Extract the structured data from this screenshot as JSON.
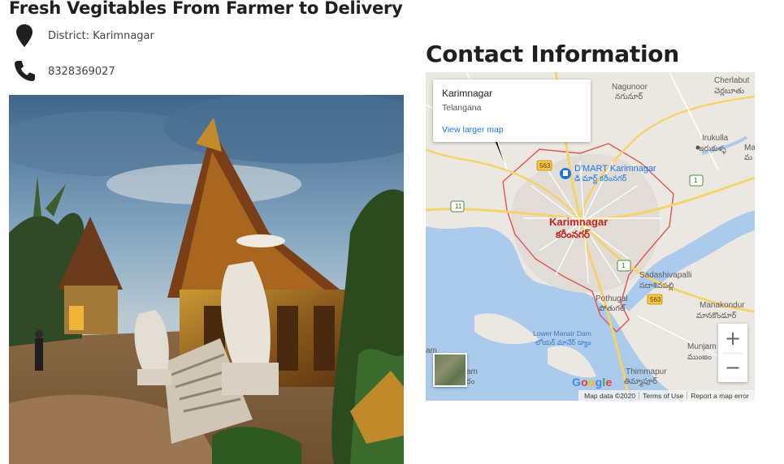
{
  "header": {
    "title": "Fresh Vegitables From Farmer to Delivery"
  },
  "contact": {
    "district": "District: Karimnagar",
    "phone": "8328369027",
    "icons": {
      "location": "map-marker-icon",
      "phone": "phone-icon"
    }
  },
  "photo": {
    "alt": "Temple photograph"
  },
  "contact_heading": "Contact Information",
  "map": {
    "info_card": {
      "place": "Karimnagar",
      "state": "Telangana",
      "link": "View larger map"
    },
    "labels": {
      "nagunoor": "Nagunoor",
      "nagunoor_te": "నగునూర్",
      "cherlabut": "Cherlabut",
      "cherlabut_te": "చెర్లబూతు",
      "irukulla": "Irukulla",
      "irukulla_te": "ఇరుకుళ్ళ",
      "dmart": "D'MART Karimnagar",
      "dmart_te": "డి మార్ట్ కరీంనగర్",
      "city": "Karimnagar",
      "city_te": "కరీంనగర్",
      "sadashivapalli": "Sadashivapalli",
      "sadashivapalli_te": "సదాశివపల్లి",
      "pothugal": "Pothugal",
      "pothugal_te": "పోతుగల్",
      "manakondur": "Manakondur",
      "manakondur_te": "మానకొండూర్",
      "lmd": "Lower Manair Dam",
      "lmd_te": "లోయర్ మానేర్ డ్యాం",
      "munjam": "Munjam",
      "munjam_te": "ముంజం",
      "thimmapur": "Thimmapur",
      "thimmapur_te": "తిమ్మాపూర్",
      "am": "am",
      "am2": "am",
      "am2_te": "రం",
      "ma": "Ma",
      "ma_te": "మ",
      "hwy_563": "563",
      "hwy_563b": "563",
      "hwy_11": "11",
      "hwy_1": "1",
      "hwy_1b": "1"
    },
    "zoom": {
      "in": "+",
      "out": "−"
    },
    "google": [
      "G",
      "o",
      "o",
      "g",
      "l",
      "e"
    ],
    "attribution": {
      "data": "Map data ©2020",
      "terms": "Terms of Use",
      "report": "Report a map error"
    }
  }
}
